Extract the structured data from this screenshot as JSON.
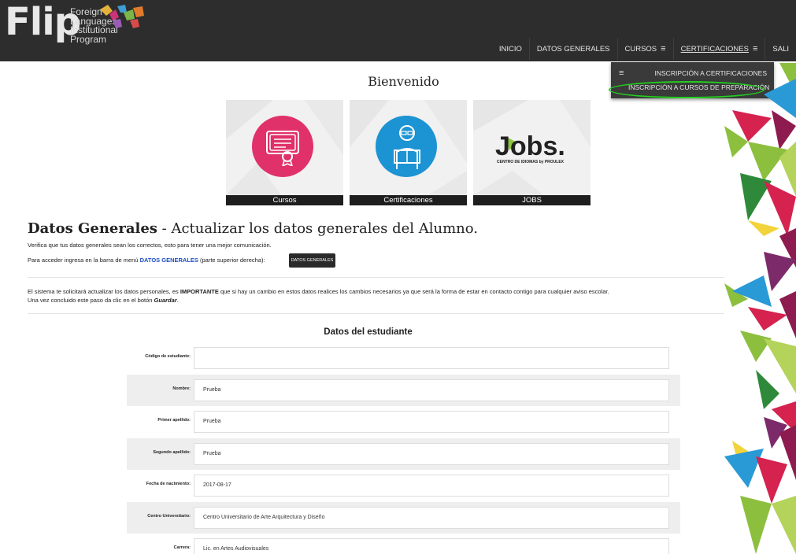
{
  "header": {
    "logo_text": "Flip",
    "logo_lines": [
      "Foreign",
      "Languages",
      "Institutional",
      "Program"
    ],
    "nav": [
      {
        "label": "INICIO"
      },
      {
        "label": "DATOS GENERALES"
      },
      {
        "label": "CURSOS",
        "icon": "menu-icon"
      },
      {
        "label": "CERTIFICACIONES",
        "icon": "menu-icon"
      },
      {
        "label": "SALI"
      }
    ],
    "dropdown": {
      "items": [
        "INSCRIPCIÓN A CERTIFICACIONES",
        "INSCRIPCIÓN A CURSOS DE PREPARACIÓN"
      ]
    }
  },
  "welcome": "Bienvenido",
  "tiles": [
    {
      "caption": "Cursos",
      "color": "#e0316a"
    },
    {
      "caption": "Certificaciones",
      "color": "#1c93d2"
    },
    {
      "caption": "JOBS",
      "logo_text": "Jobs.",
      "logo_sub": "CENTRO DE IDIOMAS by PROULEX"
    }
  ],
  "datos_generales": {
    "title_bold": "Datos Generales",
    "title_rest": " - Actualizar los datos generales del Alumno.",
    "line1": "Verifica que tus datos generales sean los correctos, esto para tener una mejor comunicación.",
    "line2_pre": "Para acceder ingresa en la barra de menú ",
    "line2_link": "DATOS GENERALES",
    "line2_post": " (parte superior derecha):",
    "button": "DATOS GENERALES",
    "para1_pre": "El sistema te solicitará actualizar los datos personales, es ",
    "para1_bold": "IMPORTANTE",
    "para1_post": " que si hay un cambio en estos datos realices los cambios necesarios ya que será la forma de estar en contacto contigo para cualquier aviso escolar.",
    "para2_pre": "Una vez concluido este paso da clic en el botón ",
    "para2_bold": "Guardar",
    "para2_post": "."
  },
  "form": {
    "title": "Datos del estudiante",
    "rows": [
      {
        "label": "Código de estudiante:",
        "value": ""
      },
      {
        "label": "Nombre:",
        "value": "Prueba"
      },
      {
        "label": "Primer apellido:",
        "value": "Prueba"
      },
      {
        "label": "Segundo apellido:",
        "value": "Prueba"
      },
      {
        "label": "Fecha de nacimiento:",
        "value": "2017-08-17"
      },
      {
        "label": "Centro Universitario:",
        "value": "Centro Universitario de Arte Arquitectura y Diseño"
      },
      {
        "label": "Carrera:",
        "value": "Lic. en Artes Audiovisuales"
      }
    ]
  },
  "colors": {
    "header_bg": "#2d2d2d",
    "highlight": "#22d11e",
    "link_blue": "#1d4fc2"
  }
}
